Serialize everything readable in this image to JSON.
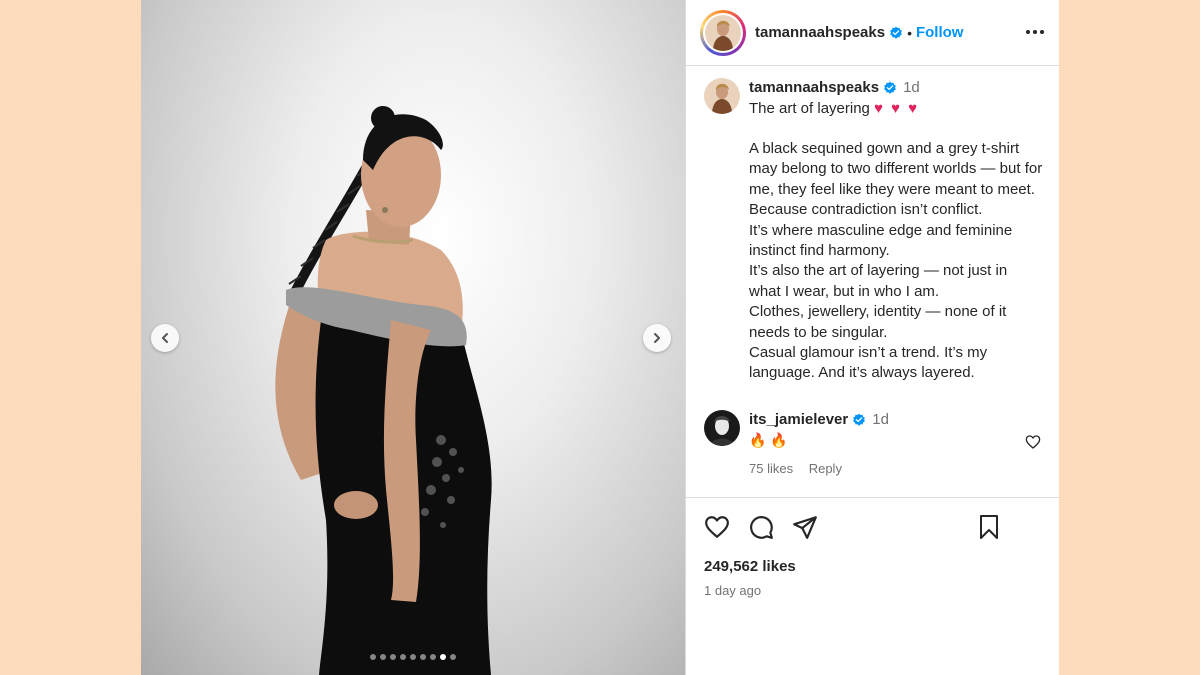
{
  "post": {
    "username": "tamannaahspeaks",
    "follow_label": "Follow",
    "separator": "•",
    "carousel_total": 9,
    "carousel_index": 8
  },
  "caption": {
    "username": "tamannaahspeaks",
    "time": "1d",
    "headline": "The art of layering",
    "hearts": "♥ ♥ ♥",
    "body": "A black sequined gown and a grey t-shirt may belong to two different worlds — but for me, they feel like they were meant to meet.\nBecause contradiction isn’t conflict.\nIt’s where masculine edge and feminine instinct find harmony.\nIt’s also the art of layering — not just in what I wear, but in who I am.\nClothes, jewellery, identity — none of it needs to be singular.\nCasual glamour isn’t a trend. It’s my language. And it’s always layered."
  },
  "comment": {
    "username": "its_jamielever",
    "time": "1d",
    "text": "🔥 🔥",
    "likes": "75 likes",
    "reply_label": "Reply"
  },
  "footer": {
    "likes": "249,562 likes",
    "ago": "1 day ago"
  },
  "colors": {
    "page_bg": "#fcdcbd",
    "link": "#0095f6",
    "verified": "#0095f6",
    "heart": "#e0245e"
  },
  "icons": [
    "chevron-left-icon",
    "chevron-right-icon",
    "verified-badge-icon",
    "more-icon",
    "heart-icon",
    "comment-icon",
    "share-icon",
    "bookmark-icon"
  ]
}
